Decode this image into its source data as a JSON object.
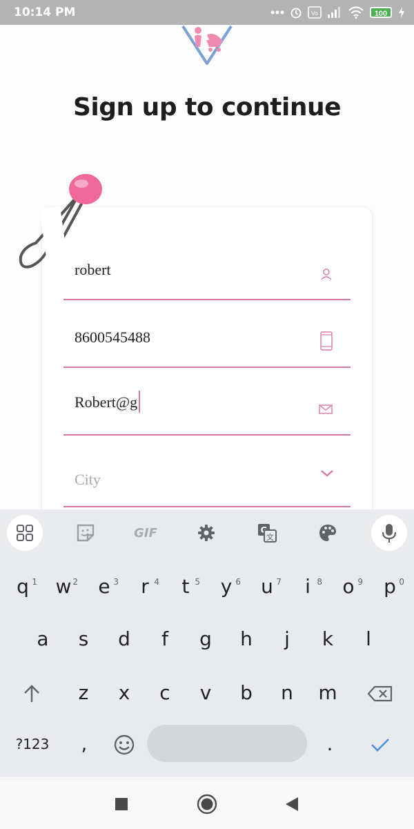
{
  "status_bar": {
    "time": "10:14 PM",
    "battery": "100",
    "icons": [
      "dots-icon",
      "alarm-icon",
      "volte-icon",
      "signal-icon",
      "wifi-icon",
      "battery-icon",
      "charging-icon"
    ]
  },
  "page": {
    "title": "Sign up to continue"
  },
  "form": {
    "name_value": "robert",
    "phone_value": "8600545488",
    "email_value": "Robert@g",
    "city_placeholder": "City"
  },
  "keyboard": {
    "toolbar_icons": [
      "apps-grid-icon",
      "sticker-icon",
      "gif-icon",
      "settings-gear-icon",
      "translate-icon",
      "palette-icon",
      "mic-icon"
    ],
    "gif_label": "GIF",
    "row1": [
      {
        "k": "q",
        "h": "1"
      },
      {
        "k": "w",
        "h": "2"
      },
      {
        "k": "e",
        "h": "3"
      },
      {
        "k": "r",
        "h": "4"
      },
      {
        "k": "t",
        "h": "5"
      },
      {
        "k": "y",
        "h": "6"
      },
      {
        "k": "u",
        "h": "7"
      },
      {
        "k": "i",
        "h": "8"
      },
      {
        "k": "o",
        "h": "9"
      },
      {
        "k": "p",
        "h": "0"
      }
    ],
    "row2": [
      "a",
      "s",
      "d",
      "f",
      "g",
      "h",
      "j",
      "k",
      "l"
    ],
    "row3": [
      "z",
      "x",
      "c",
      "v",
      "b",
      "n",
      "m"
    ],
    "symbols_label": "?123",
    "comma": ",",
    "period": "."
  },
  "colors": {
    "accent": "#d57aa6",
    "status_bar": "#b3b3b3",
    "keyboard_bg": "#e8eaed",
    "check": "#4a90d9"
  }
}
